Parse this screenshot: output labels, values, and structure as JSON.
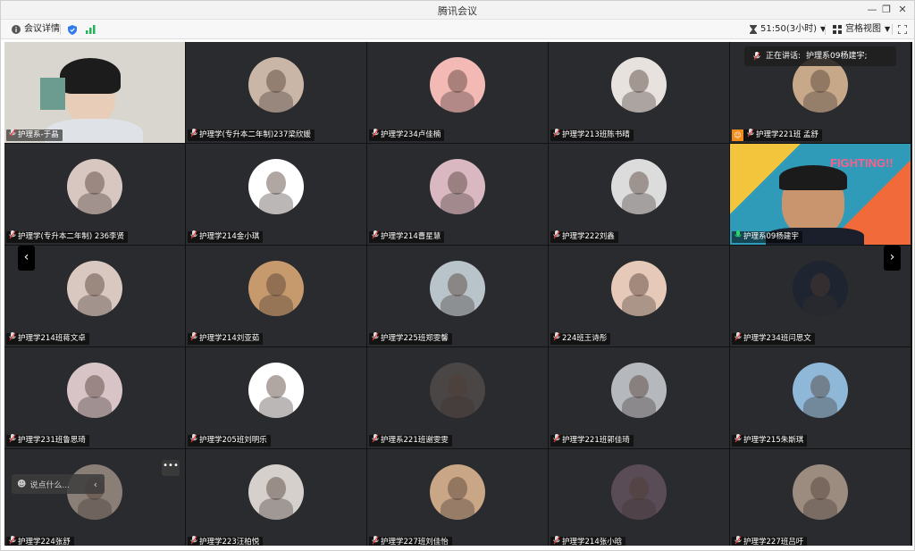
{
  "window": {
    "title": "腾讯会议"
  },
  "toolbar": {
    "meeting_details": "会议详情",
    "timer": "51:50(3小时)",
    "view_mode": "宫格视图"
  },
  "speaking": {
    "prefix": "正在讲话:",
    "name": "护理系09杨建宇;"
  },
  "chat": {
    "placeholder": "说点什么..."
  },
  "participants": [
    {
      "name": "护理系-于晶",
      "video": true,
      "bg": "#d9d6cf"
    },
    {
      "name": "护理学(专升本二年制)237梁欣媛",
      "bg": "#c9b6a6"
    },
    {
      "name": "护理学234卢佳楠",
      "bg": "#f2b9b5"
    },
    {
      "name": "护理学213班陈书晴",
      "bg": "#e8e2df"
    },
    {
      "name": "护理学221班 孟舒",
      "bg": "#c7a98a"
    },
    {
      "name": "护理学(专升本二年制) 236李贤",
      "bg": "#d8c7c1"
    },
    {
      "name": "护理学214金小琪",
      "bg": "#ffffff"
    },
    {
      "name": "护理学214曹星慧",
      "bg": "#d9b8c2"
    },
    {
      "name": "护理学222刘鑫",
      "bg": "#dcdcdc"
    },
    {
      "name": "护理系09杨建宇",
      "video": true,
      "bg": "#2f9bb8"
    },
    {
      "name": "护理学214班蒋文卓",
      "bg": "#d9c8c0"
    },
    {
      "name": "护理学214刘亚茹",
      "bg": "#c79a6e"
    },
    {
      "name": "护理学225班郑雯馨",
      "bg": "#b8c4c9"
    },
    {
      "name": "224班王诗彤",
      "bg": "#e6c9b8"
    },
    {
      "name": "护理学234班闫思文",
      "bg": "#1e2430"
    },
    {
      "name": "护理学231班鲁思琦",
      "bg": "#d8c4c7"
    },
    {
      "name": "护理学205班刘明乐",
      "bg": "#ffffff"
    },
    {
      "name": "护理系221班谢雯雯",
      "bg": "#4a4645"
    },
    {
      "name": "护理学221班郭佳琦",
      "bg": "#b5b9bd"
    },
    {
      "name": "护理学215朱斯琪",
      "bg": "#8fb8d8"
    },
    {
      "name": "护理学224张舒",
      "bg": "#8a7f77"
    },
    {
      "name": "护理学223汪柏悦",
      "bg": "#d6d0cc"
    },
    {
      "name": "护理学227班刘佳怡",
      "bg": "#c8a686"
    },
    {
      "name": "护理学214张小晗",
      "bg": "#5a4c57"
    },
    {
      "name": "护理学227班吕吁",
      "bg": "#9c8c80"
    }
  ]
}
